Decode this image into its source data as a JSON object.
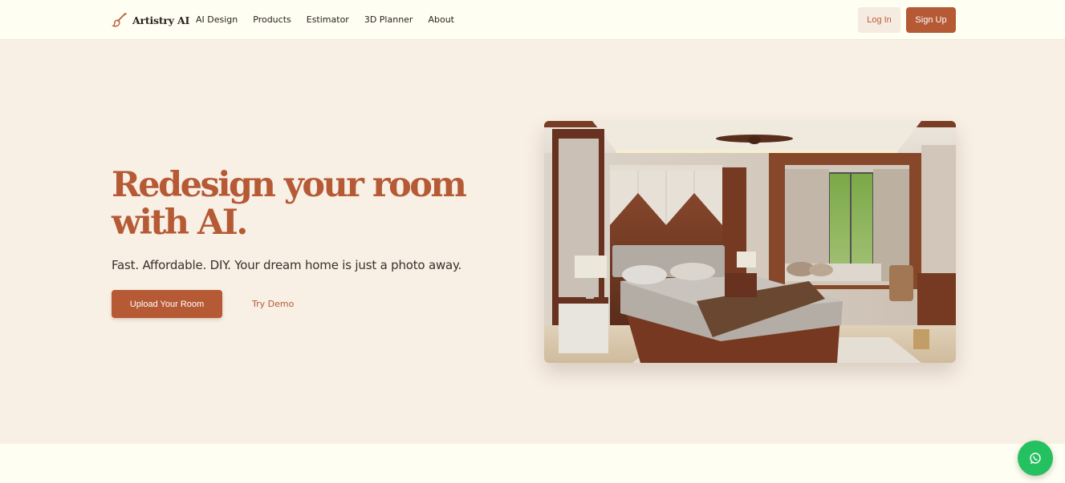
{
  "brand": {
    "name": "Artistry AI",
    "icon": "paintbrush-icon"
  },
  "nav": {
    "links": [
      "AI Design",
      "Products",
      "Estimator",
      "3D Planner",
      "About"
    ],
    "login_label": "Log In",
    "signup_label": "Sign Up"
  },
  "hero": {
    "title_line1": "Redesign your room",
    "title_line2": "with AI.",
    "subtitle": "Fast. Affordable. DIY. Your dream home is just a photo away.",
    "upload_label": "Upload Your Room",
    "demo_label": "Try Demo"
  },
  "floating": {
    "chat_icon": "whatsapp-icon"
  },
  "colors": {
    "accent": "#b55a35",
    "hero_bg": "#f8efe5",
    "page_bg": "#fefef2",
    "whatsapp": "#25c05f"
  }
}
